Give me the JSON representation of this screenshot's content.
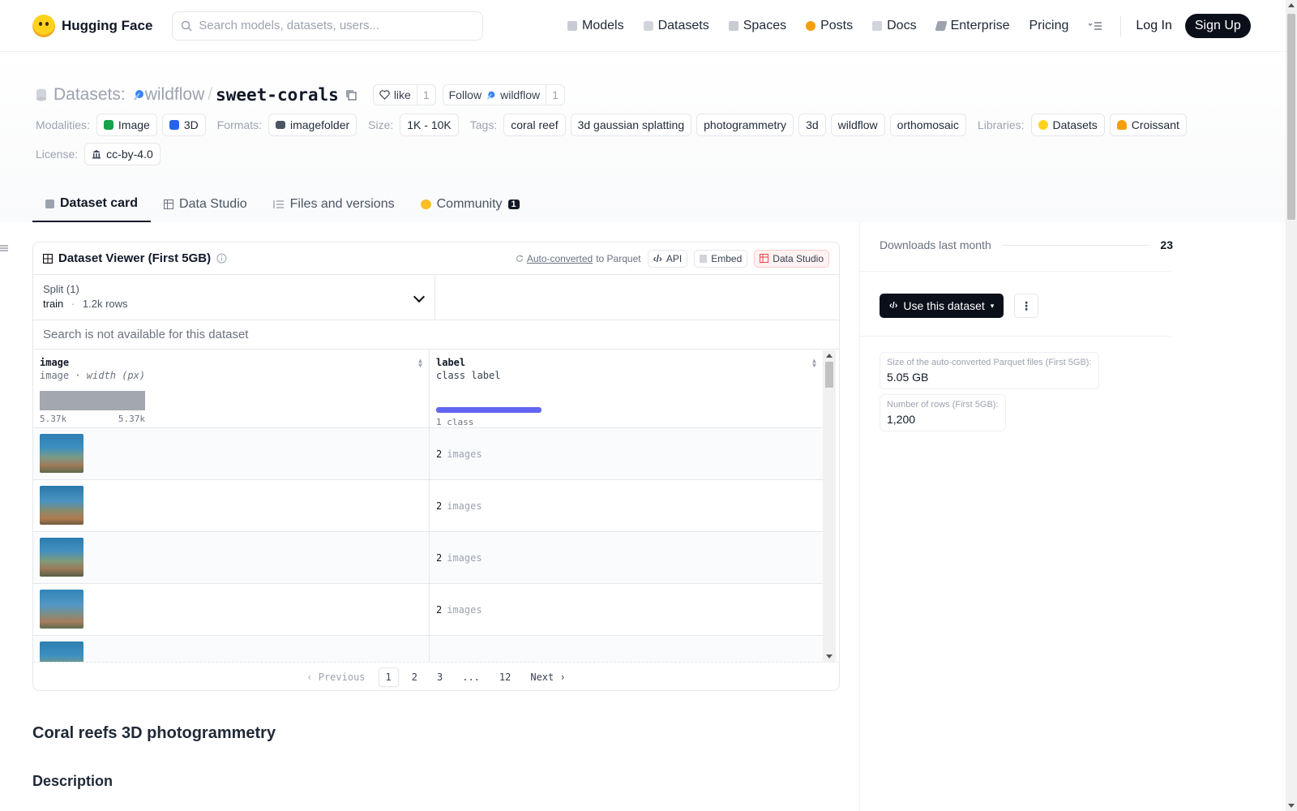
{
  "nav": {
    "brand": "Hugging Face",
    "search_placeholder": "Search models, datasets, users...",
    "links": [
      "Models",
      "Datasets",
      "Spaces",
      "Posts",
      "Docs",
      "Enterprise",
      "Pricing"
    ],
    "login": "Log In",
    "signup": "Sign Up"
  },
  "header": {
    "section": "Datasets:",
    "owner": "wildflow",
    "slash": "/",
    "name": "sweet-corals",
    "like_label": "like",
    "like_count": "1",
    "follow_label": "Follow",
    "follow_owner": "wildflow",
    "follow_count": "1",
    "modalities_key": "Modalities:",
    "modalities": [
      "Image",
      "3D"
    ],
    "formats_key": "Formats:",
    "format": "imagefolder",
    "size_key": "Size:",
    "size": "1K - 10K",
    "tags_key": "Tags:",
    "tags": [
      "coral reef",
      "3d gaussian splatting",
      "photogrammetry",
      "3d",
      "wildflow",
      "orthomosaic"
    ],
    "libraries_key": "Libraries:",
    "libraries": [
      "Datasets",
      "Croissant"
    ],
    "license_key": "License:",
    "license": "cc-by-4.0"
  },
  "tabs": [
    {
      "label": "Dataset card"
    },
    {
      "label": "Data Studio"
    },
    {
      "label": "Files and versions"
    },
    {
      "label": "Community",
      "badge": "1"
    }
  ],
  "viewer": {
    "title": "Dataset Viewer (First 5GB)",
    "auto_converted": "Auto-converted",
    "to_parquet": "to Parquet",
    "api": "API",
    "embed": "Embed",
    "data_studio": "Data Studio",
    "split_label": "Split (1)",
    "split_name": "train",
    "split_sep": "·",
    "split_rows": "1.2k rows",
    "search_na": "Search is not available for this dataset",
    "col1_name": "image",
    "col1_type": "image",
    "col1_sub": "· width (px)",
    "hist_min": "5.37k",
    "hist_max": "5.37k",
    "col2_name": "label",
    "col2_type": "class label",
    "class_count": "1 class",
    "rows": [
      {
        "value": "2",
        "label": "images"
      },
      {
        "value": "2",
        "label": "images"
      },
      {
        "value": "2",
        "label": "images"
      },
      {
        "value": "2",
        "label": "images"
      }
    ],
    "pager": {
      "prev": "Previous",
      "pages": [
        "1",
        "2",
        "3",
        "...",
        "12"
      ],
      "next": "Next"
    }
  },
  "card": {
    "title": "Coral reefs 3D photogrammetry",
    "section": "Description"
  },
  "side": {
    "downloads_label": "Downloads last month",
    "downloads": "23",
    "use_button": "Use this dataset",
    "parquet_size_label": "Size of the auto-converted Parquet files (First 5GB):",
    "parquet_size": "5.05 GB",
    "rows_label": "Number of rows (First 5GB):",
    "rows_value": "1,200"
  },
  "colors": {
    "accent": "#6366f1",
    "dark": "#0b0f19",
    "brand_yellow": "#ffd21e"
  }
}
